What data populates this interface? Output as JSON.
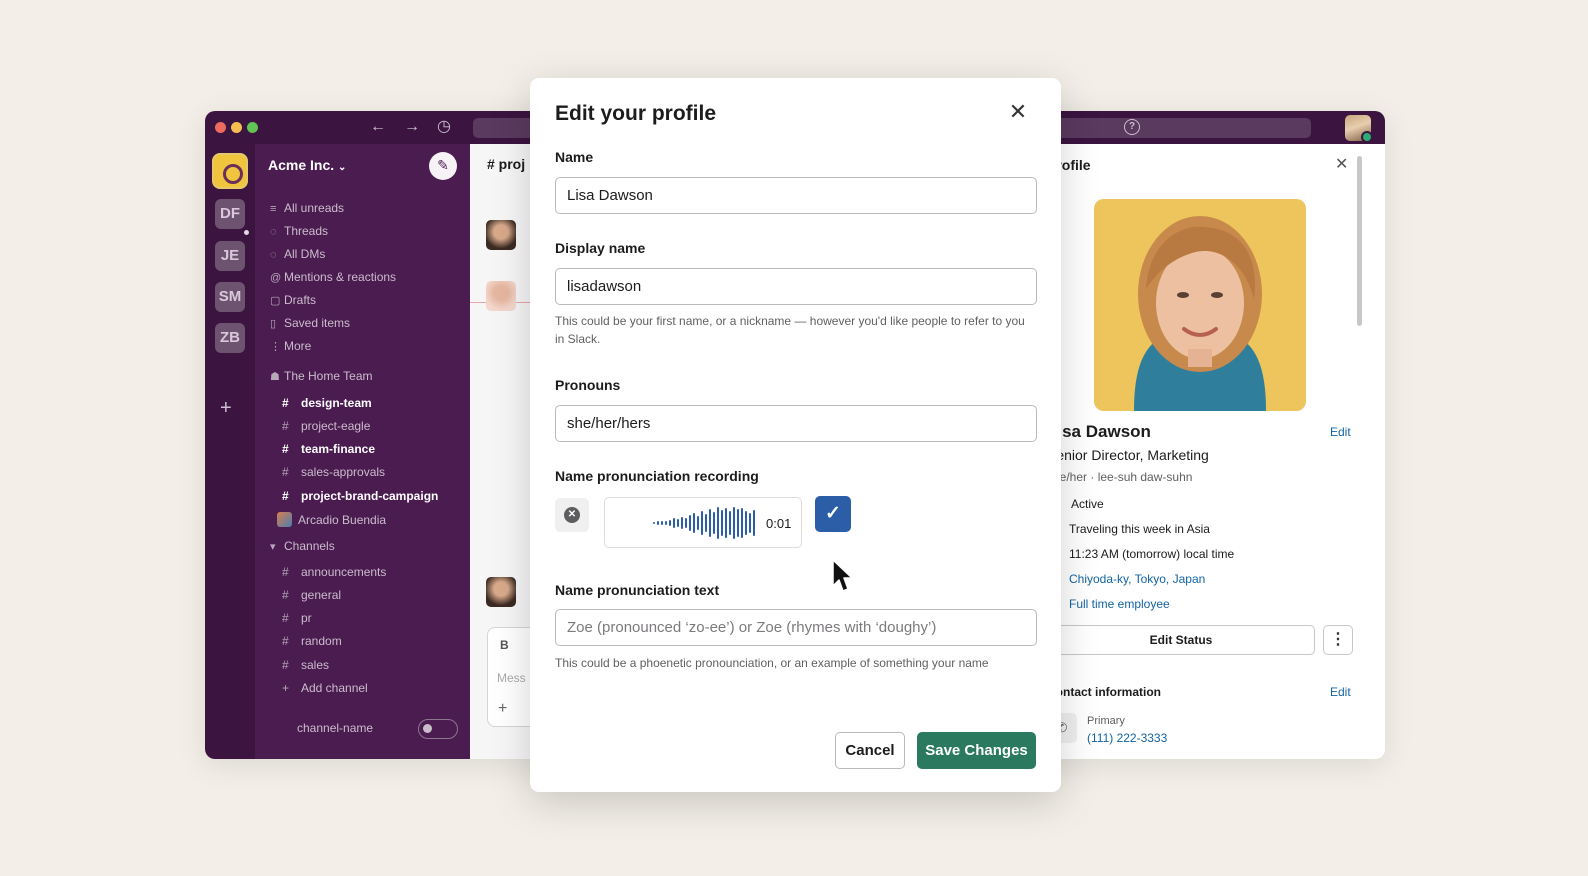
{
  "workspace": {
    "name": "Acme Inc.",
    "switcher": [
      "DF",
      "JE",
      "SM",
      "ZB"
    ]
  },
  "sidebar": {
    "nav": [
      {
        "label": "All unreads",
        "icon": "list-icon"
      },
      {
        "label": "Threads",
        "icon": "threads-icon"
      },
      {
        "label": "All DMs",
        "icon": "dms-icon"
      },
      {
        "label": "Mentions & reactions",
        "icon": "at-icon"
      },
      {
        "label": "Drafts",
        "icon": "drafts-icon"
      },
      {
        "label": "Saved items",
        "icon": "bookmark-icon"
      },
      {
        "label": "More",
        "icon": "more-icon"
      }
    ],
    "section_team": "The Home Team",
    "team_channels": [
      "design-team",
      "project-eagle",
      "team-finance",
      "sales-approvals",
      "project-brand-campaign"
    ],
    "dm": "Arcadio Buendia",
    "section_channels": "Channels",
    "channels": [
      "announcements",
      "general",
      "pr",
      "random",
      "sales"
    ],
    "add_channel": "Add channel",
    "footer_channel": "channel-name"
  },
  "center": {
    "header": "# proj",
    "composer_bold": "B",
    "composer_placeholder": "Mess"
  },
  "profile": {
    "title": "Profile",
    "name": "Lisa Dawson",
    "edit": "Edit",
    "role": "Senior Director, Marketing",
    "pronouns_line": "she/her · lee-suh daw-suhn",
    "status": "Active",
    "travel": "Traveling this week in Asia",
    "local_time": "11:23 AM (tomorrow) local time",
    "location": "Chiyoda-ky, Tokyo, Japan",
    "employment": "Full time employee",
    "edit_status": "Edit Status",
    "contact_title": "Contact information",
    "contact_edit": "Edit",
    "phone_label": "Primary",
    "phone": "(111) 222-3333"
  },
  "modal": {
    "title": "Edit your profile",
    "name_label": "Name",
    "name_value": "Lisa Dawson",
    "display_label": "Display name",
    "display_value": "lisadawson",
    "display_hint": "This could be your first name, or a nickname — however you'd like people to refer to you in Slack.",
    "pronouns_label": "Pronouns",
    "pronouns_value": "she/her/hers",
    "recording_label": "Name pronunciation recording",
    "recording_time": "0:01",
    "pron_text_label": "Name pronunciation text",
    "pron_text_placeholder": "Zoe (pronounced ‘zo-ee’) or Zoe (rhymes with ‘doughy’)",
    "pron_text_hint": "This could be a phoenetic pronounciation, or an example of something your name",
    "cancel": "Cancel",
    "save": "Save Changes"
  },
  "colors": {
    "aubergine": "#4a1c50",
    "save_green": "#2b7a60",
    "check_blue": "#2b5ea7",
    "link_blue": "#1264a3"
  }
}
